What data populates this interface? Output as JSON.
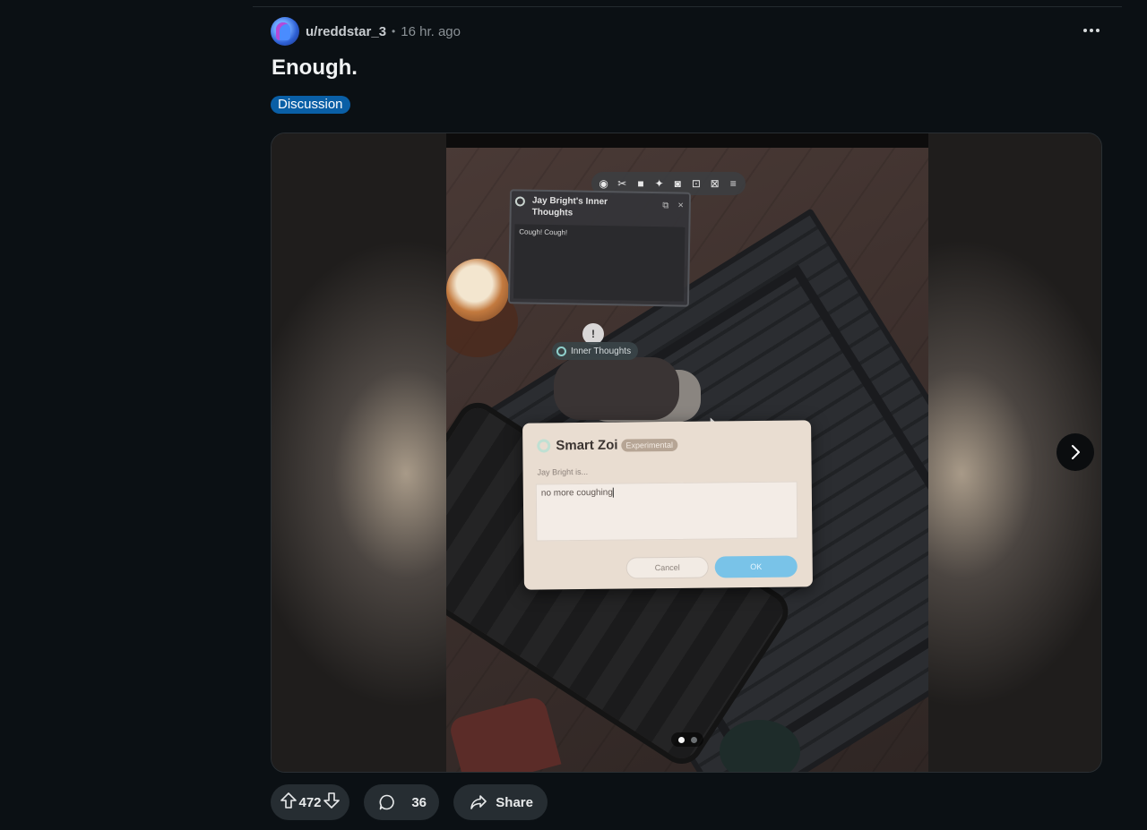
{
  "post": {
    "author": "u/reddstar_3",
    "separator": "•",
    "time": "16 hr. ago",
    "title": "Enough.",
    "flair": "Discussion",
    "more_label": "•••"
  },
  "screenshot": {
    "toolbar_icons": [
      "headset-icon",
      "tool-icon",
      "camera-video-icon",
      "sparkle-icon",
      "camera-icon",
      "focus-icon",
      "select-icon",
      "menu-icon"
    ],
    "thoughts_panel": {
      "title": "Jay Bright's Inner Thoughts",
      "body": "Cough! Cough!",
      "copy_glyph": "⧉",
      "close_glyph": "×"
    },
    "marker_glyph": "!",
    "inner_thoughts_label": "Inner Thoughts",
    "dialog": {
      "title": "Smart Zoi",
      "badge": "Experimental",
      "label": "Jay Bright is...",
      "value": "no more coughing",
      "cancel": "Cancel",
      "ok": "OK"
    }
  },
  "carousel": {
    "count": 2,
    "active_index": 0
  },
  "actions": {
    "votes": "472",
    "comments": "36",
    "share": "Share"
  }
}
